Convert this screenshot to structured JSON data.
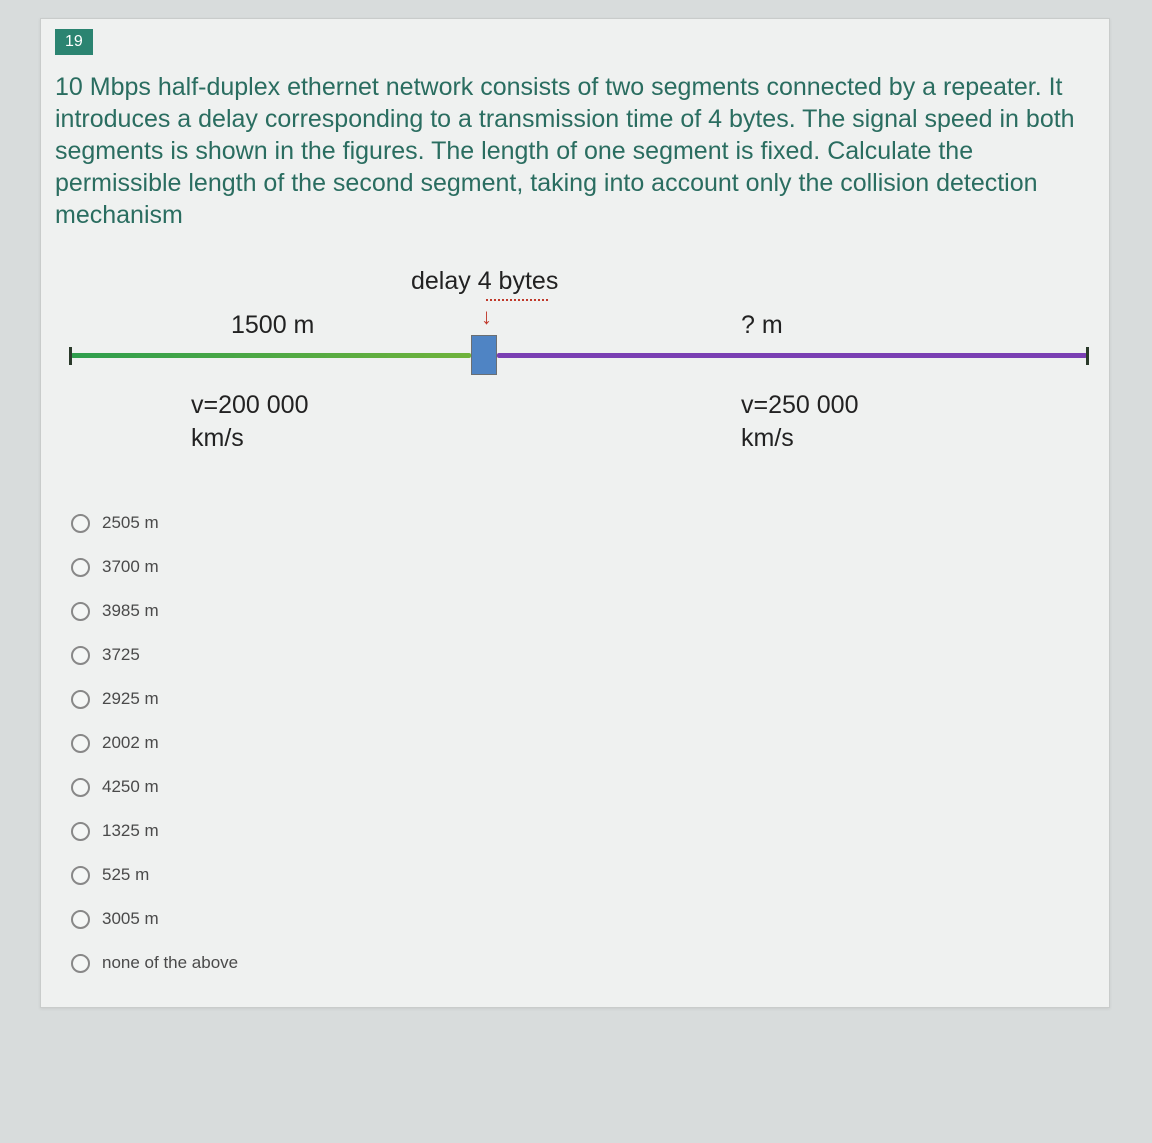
{
  "question_number": "19",
  "question_text": "10 Mbps half-duplex ethernet network consists of two segments connected by a repeater. It introduces a delay corresponding to a transmission time of 4 bytes. The signal speed in both segments is shown in the figures. The length of one segment is fixed. Calculate the permissible length of the second segment, taking into account only the collision detection mechanism",
  "diagram": {
    "delay_label": "delay 4 bytes",
    "seg1_length": "1500 m",
    "seg2_length": "? m",
    "v1_line1": "v=200 000",
    "v1_line2": "km/s",
    "v2_line1": "v=250 000",
    "v2_line2": "km/s"
  },
  "options": [
    "2505 m",
    "3700 m",
    "3985 m",
    "3725",
    "2925 m",
    "2002 m",
    "4250 m",
    "1325 m",
    "525 m",
    "3005 m",
    "none of the above"
  ]
}
